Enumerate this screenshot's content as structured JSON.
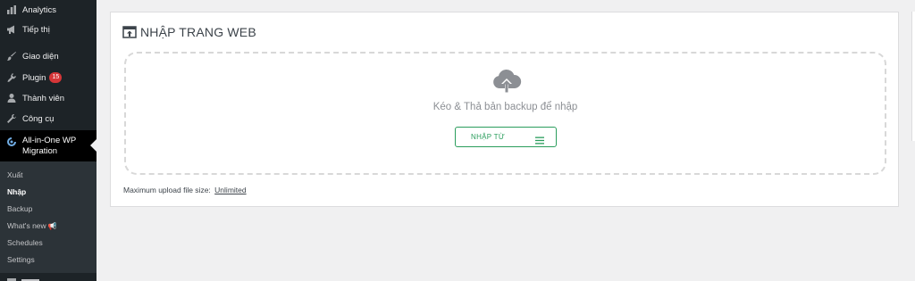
{
  "sidebar": {
    "items": [
      {
        "label": "Analytics",
        "icon": "chart-bar-icon"
      },
      {
        "label": "Tiếp thị",
        "icon": "megaphone-icon"
      },
      {
        "label": "Giao diện",
        "icon": "brush-icon"
      },
      {
        "label": "Plugin",
        "icon": "plugin-icon",
        "badge": "15"
      },
      {
        "label": "Thành viên",
        "icon": "user-icon"
      },
      {
        "label": "Công cụ",
        "icon": "wrench-icon"
      }
    ],
    "active": {
      "label": "All-in-One WP Migration",
      "icon": "migration-icon"
    },
    "submenu": [
      {
        "label": "Xuất"
      },
      {
        "label": "Nhập"
      },
      {
        "label": "Backup"
      },
      {
        "label": "What's new",
        "icon": "megaphone-small-icon"
      },
      {
        "label": "Schedules"
      },
      {
        "label": "Settings"
      }
    ]
  },
  "panel": {
    "title": "NHẬP TRANG WEB",
    "title_icon": "import-upload-icon",
    "drop_text": "Kéo & Thả bản backup để nhập",
    "import_button": "NHẬP TỪ",
    "max_upload_label": "Maximum upload file size:",
    "max_upload_value": "Unlimited"
  },
  "colors": {
    "sidebar_bg": "#1d2327",
    "submenu_bg": "#2c3338",
    "accent_green": "#2a9d5c",
    "badge_red": "#d63638",
    "active_icon": "#72aee6"
  }
}
